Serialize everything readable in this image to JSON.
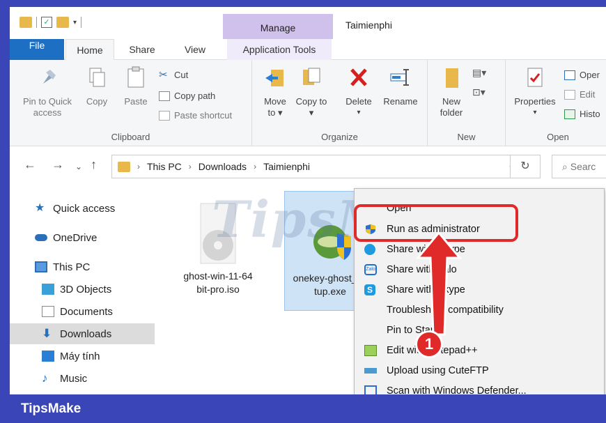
{
  "window": {
    "title": "Taimienphi",
    "manage_tab": "Manage"
  },
  "tabs": [
    "File",
    "Home",
    "Share",
    "View",
    "Application Tools"
  ],
  "ribbon": {
    "clipboard": {
      "label": "Clipboard",
      "pin": "Pin to Quick access",
      "copy": "Copy",
      "paste": "Paste",
      "cut": "Cut",
      "copy_path": "Copy path",
      "paste_shortcut": "Paste shortcut"
    },
    "organize": {
      "label": "Organize",
      "move_to": "Move to ▾",
      "copy_to": "Copy to ▾",
      "delete": "Delete",
      "rename": "Rename"
    },
    "new": {
      "label": "New",
      "new_folder": "New folder"
    },
    "open": {
      "label": "Open",
      "properties": "Properties",
      "open": "Oper",
      "edit": "Edit",
      "history": "Histo"
    }
  },
  "address": {
    "crumbs": [
      "This PC",
      "Downloads",
      "Taimienphi"
    ],
    "search_placeholder": "Searc"
  },
  "sidebar": {
    "items": [
      {
        "label": "Quick access",
        "icon": "star-icon"
      },
      {
        "label": "OneDrive",
        "icon": "cloud-icon"
      },
      {
        "label": "This PC",
        "icon": "computer-icon"
      },
      {
        "label": "3D Objects",
        "icon": "cube-icon"
      },
      {
        "label": "Documents",
        "icon": "document-icon"
      },
      {
        "label": "Downloads",
        "icon": "download-icon"
      },
      {
        "label": "Máy tính",
        "icon": "monitor-icon"
      },
      {
        "label": "Music",
        "icon": "music-icon"
      }
    ]
  },
  "files": [
    {
      "name": "ghost-win-11-64 bit-pro.iso",
      "line1": "ghost-win-11-64",
      "line2": "bit-pro.iso"
    },
    {
      "name": "onekey-ghost_setup.exe",
      "line1": "onekey-ghost_se",
      "line2": "tup.exe"
    }
  ],
  "context_menu": {
    "items": [
      "Open",
      "Run as administrator",
      "Share with Skype",
      "Share with Zalo",
      "Share with Skype",
      "Troubleshoot compatibility",
      "Pin to Start",
      "Edit with Notepad++",
      "Upload using CuteFTP",
      "Scan with Windows Defender..."
    ]
  },
  "annotation": {
    "step": "1"
  },
  "watermark": "TipsMake",
  "footer": {
    "brand": "TipsMake"
  },
  "colors": {
    "accent": "#1d6fc3",
    "highlight": "#e02a2a",
    "footer": "#3a45b8"
  }
}
